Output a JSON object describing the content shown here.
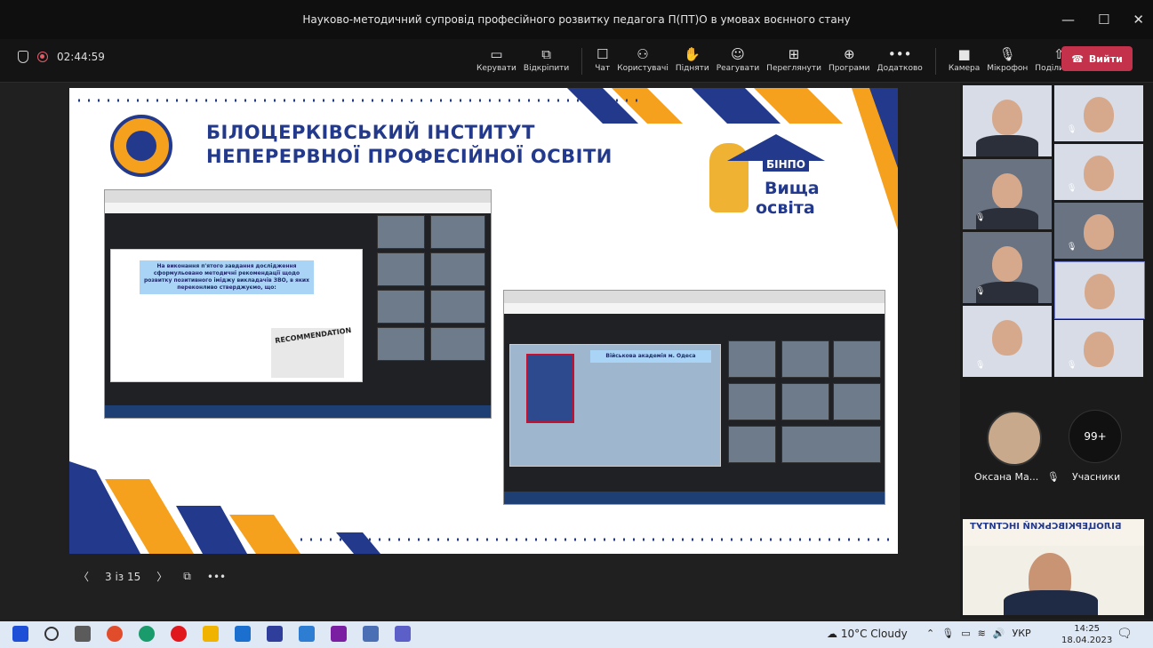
{
  "window": {
    "title": "Науково-методичний супровід професійного розвитку педагога П(ПТ)О в умовах воєнного стану"
  },
  "meeting": {
    "timer": "02:44:59",
    "leave_label": "Вийти"
  },
  "toolbar": [
    {
      "label": "Керувати",
      "icon": "manage-icon",
      "glyph": "▭"
    },
    {
      "label": "Відкріпити",
      "icon": "popout-icon",
      "glyph": "⧉"
    },
    {
      "label": "Чат",
      "icon": "chat-icon",
      "glyph": "☐"
    },
    {
      "label": "Користувачі",
      "icon": "people-icon",
      "glyph": "⚇"
    },
    {
      "label": "Підняти",
      "icon": "raise-hand-icon",
      "glyph": "✋"
    },
    {
      "label": "Реагувати",
      "icon": "react-icon",
      "glyph": "☺"
    },
    {
      "label": "Переглянути",
      "icon": "view-icon",
      "glyph": "⊞"
    },
    {
      "label": "Програми",
      "icon": "apps-icon",
      "glyph": "⊕"
    },
    {
      "label": "Додатково",
      "icon": "more-icon",
      "glyph": "•••"
    },
    {
      "label": "Камера",
      "icon": "camera-icon",
      "glyph": "■"
    },
    {
      "label": "Мікрофон",
      "icon": "mic-off-icon",
      "glyph": "🎙"
    },
    {
      "label": "Поділитися",
      "icon": "share-icon",
      "glyph": "⇧"
    }
  ],
  "slide": {
    "institute_line1": "БІЛОЦЕРКІВСЬКИЙ ІНСТИТУТ",
    "institute_line2": "НЕПЕРЕРВНОЇ ПРОФЕСІЙНОЇ ОСВІТИ",
    "logo_tag": "БІНПО",
    "logo_text1": "Вища",
    "logo_text2": "освіта",
    "shot1_box": "На виконання п'ятого завдання дослідження сформульовано методичні рекомендації щодо розвитку позитивного іміджу викладачів ЗВО, в яких переконливо стверджуємо, що:",
    "shot1_stamp": "RECOMMENDATION",
    "shot2_box": "Військова академія м. Одеса"
  },
  "pager": {
    "page": "3 із 15"
  },
  "participant": {
    "name": "Оксана Ма...",
    "count": "99+",
    "count_label": "Учасники"
  },
  "taskbar": {
    "weather": "10°C Cloudy",
    "lang": "УКР",
    "time": "14:25",
    "date": "18.04.2023"
  },
  "colors": {
    "navy": "#22398c",
    "orange": "#f5a11e",
    "leave": "#c4314b"
  }
}
